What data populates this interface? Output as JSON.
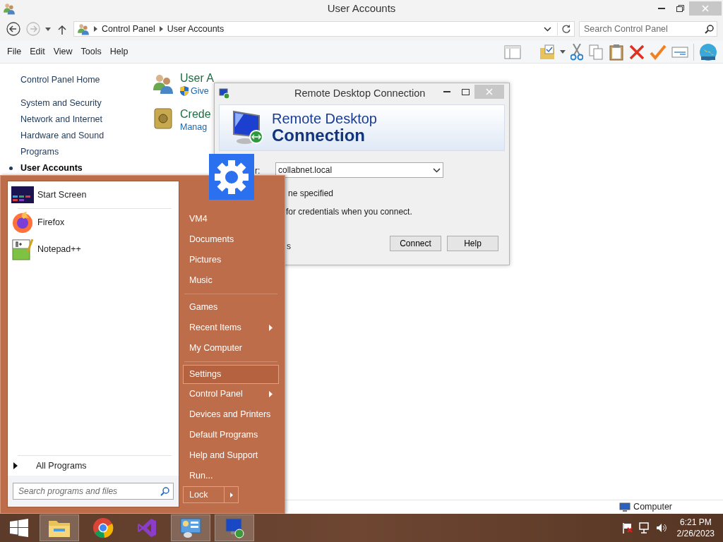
{
  "window": {
    "title": "User Accounts",
    "breadcrumb": [
      "Control Panel",
      "User Accounts"
    ],
    "search": {
      "placeholder": "Search Control Panel"
    },
    "menu": [
      "File",
      "Edit",
      "View",
      "Tools",
      "Help"
    ]
  },
  "nav": [
    {
      "label": "Control Panel Home",
      "selected": false
    },
    {
      "label": "System and Security",
      "selected": false
    },
    {
      "label": "Network and Internet",
      "selected": false
    },
    {
      "label": "Hardware and Sound",
      "selected": false
    },
    {
      "label": "Programs",
      "selected": false
    },
    {
      "label": "User Accounts",
      "selected": true
    }
  ],
  "sections": [
    {
      "kind": "users",
      "title": "User A",
      "link": "Give"
    },
    {
      "kind": "vault",
      "title": "Crede",
      "link": "Manag"
    }
  ],
  "status_bar": "Computer",
  "dialog": {
    "title": "Remote Desktop Connection",
    "banner": [
      "Remote Desktop",
      "Connection"
    ],
    "label_fragment": "r:",
    "computer": "collabnet.local",
    "user_fragment": "ne specified",
    "note_fragment": "for credentials when you connect.",
    "options_fragment": "s",
    "buttons": [
      "Connect",
      "Help"
    ]
  },
  "start_menu": {
    "pinned": [
      {
        "label": "Start Screen",
        "kind": "start"
      },
      {
        "label": "Firefox",
        "kind": "firefox"
      },
      {
        "label": "Notepad++",
        "kind": "notepad"
      }
    ],
    "all_programs": "All Programs",
    "search": {
      "placeholder": "Search programs and files"
    },
    "item_groups": [
      [
        {
          "label": "VM4",
          "submenu": false,
          "selected": false
        },
        {
          "label": "Documents",
          "submenu": false,
          "selected": false
        },
        {
          "label": "Pictures",
          "submenu": false,
          "selected": false
        },
        {
          "label": "Music",
          "submenu": false,
          "selected": false
        }
      ],
      [
        {
          "label": "Games",
          "submenu": false,
          "selected": false
        },
        {
          "label": "Recent Items",
          "submenu": true,
          "selected": false
        },
        {
          "label": "My Computer",
          "submenu": false,
          "selected": false
        }
      ],
      [
        {
          "label": "Settings",
          "submenu": false,
          "selected": true
        },
        {
          "label": "Control Panel",
          "submenu": true,
          "selected": false
        },
        {
          "label": "Devices and Printers",
          "submenu": false,
          "selected": false
        },
        {
          "label": "Default Programs",
          "submenu": false,
          "selected": false
        },
        {
          "label": "Help and Support",
          "submenu": false,
          "selected": false
        },
        {
          "label": "Run...",
          "submenu": false,
          "selected": false
        }
      ]
    ],
    "lock": "Lock"
  },
  "taskbar": {
    "apps": [
      {
        "kind": "explorer",
        "open": true
      },
      {
        "kind": "chrome",
        "open": false
      },
      {
        "kind": "studio",
        "open": false
      },
      {
        "kind": "panel",
        "open": true
      },
      {
        "kind": "remote",
        "open": true
      }
    ],
    "time": "6:21 PM",
    "date": "2/26/2023"
  }
}
